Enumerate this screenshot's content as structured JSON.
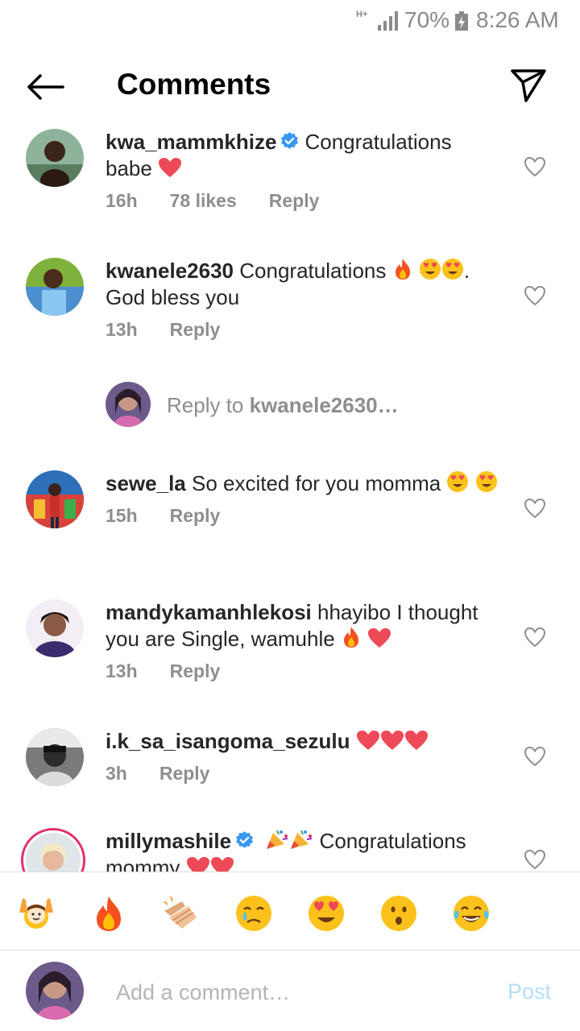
{
  "status_bar": {
    "network": "H+",
    "battery_percent": "70%",
    "time": "8:26 AM"
  },
  "header": {
    "title": "Comments",
    "back_icon": "arrow-left-icon",
    "send_icon": "paper-plane-icon"
  },
  "comments": [
    {
      "username": "kwa_mammkhize",
      "verified": true,
      "text": "Congratulations babe",
      "emojis": [
        "red-heart"
      ],
      "time": "16h",
      "likes": "78 likes",
      "reply_label": "Reply"
    },
    {
      "username": "kwanele2630",
      "verified": false,
      "text_part1": "Congratulations",
      "text_part2": ". God bless you",
      "emojis": [
        "fire",
        "heart-eyes",
        "heart-eyes"
      ],
      "time": "13h",
      "reply_label": "Reply"
    },
    {
      "username": "sewe_la",
      "verified": false,
      "text": "So excited for you momma",
      "emojis": [
        "heart-eyes",
        "heart-eyes"
      ],
      "time": "15h",
      "reply_label": "Reply"
    },
    {
      "username": "mandykamanhlekosi",
      "verified": false,
      "text": "hhayibo I thought you are Single, wamuhle",
      "emojis": [
        "fire",
        "red-heart"
      ],
      "time": "13h",
      "reply_label": "Reply"
    },
    {
      "username": "i.k_sa_isangoma_sezulu",
      "verified": false,
      "text": "",
      "emojis": [
        "red-heart",
        "red-heart",
        "red-heart"
      ],
      "time": "3h",
      "reply_label": "Reply"
    },
    {
      "username": "millymashile",
      "verified": true,
      "text": "Congratulations mommy",
      "emojis": [
        "party-popper",
        "party-popper",
        "red-heart",
        "red-heart"
      ]
    }
  ],
  "reply_prompt": {
    "prefix": "Reply to ",
    "target": "kwanele2630…"
  },
  "emoji_bar": [
    "raising-hands",
    "fire",
    "clapping-hands",
    "crying-face",
    "heart-eyes",
    "surprised-face",
    "tears-of-joy"
  ],
  "compose": {
    "placeholder": "Add a comment…",
    "post_label": "Post"
  },
  "colors": {
    "link_blue": "#3897f0",
    "post_disabled": "#b2dffc",
    "muted_text": "#8e8e8e",
    "heart_red": "#ed4956"
  }
}
